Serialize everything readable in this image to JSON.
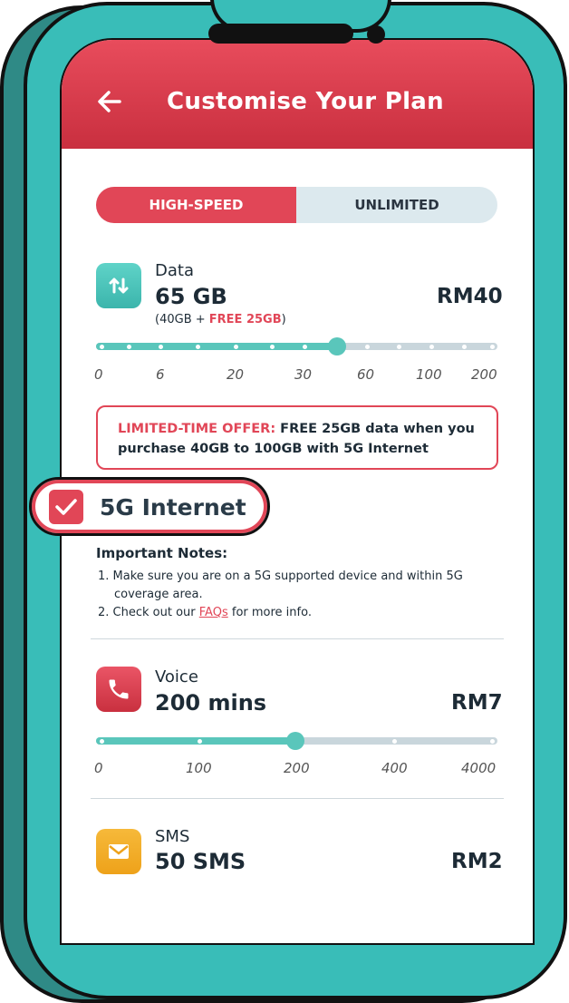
{
  "header": {
    "title": "Customise Your Plan",
    "back_icon": "arrow-left-icon"
  },
  "tabs": [
    {
      "label": "HIGH-SPEED",
      "active": true
    },
    {
      "label": "UNLIMITED",
      "active": false
    }
  ],
  "data": {
    "label": "Data",
    "amount": "65 GB",
    "price": "RM40",
    "breakdown_prefix": "(40GB + ",
    "breakdown_free": "FREE 25GB",
    "breakdown_suffix": ")",
    "ticks": [
      "0",
      "6",
      "20",
      "30",
      "60",
      "100",
      "200"
    ],
    "slider_value_fraction": 0.6
  },
  "offer": {
    "prefix": "LIMITED-TIME OFFER:",
    "line1": " FREE 25GB data when you",
    "line2": "purchase 40GB to 100GB with 5G Internet"
  },
  "internet5g": {
    "label": "5G Internet",
    "checked": true
  },
  "notes": {
    "title": "Important Notes:",
    "item1a": "1. Make sure you are on a 5G supported device and within 5G",
    "item1b": "coverage area.",
    "item2_prefix": "2. Check out our ",
    "item2_link": "FAQs",
    "item2_suffix": " for more info."
  },
  "voice": {
    "label": "Voice",
    "amount": "200 mins",
    "price": "RM7",
    "ticks": [
      "0",
      "100",
      "200",
      "400",
      "4000"
    ],
    "slider_value_fraction": 0.5
  },
  "sms": {
    "label": "SMS",
    "amount": "50 SMS",
    "price": "RM2"
  },
  "colors": {
    "accent": "#e14657",
    "teal": "#5ac6bb",
    "frame": "#39bdb8"
  }
}
